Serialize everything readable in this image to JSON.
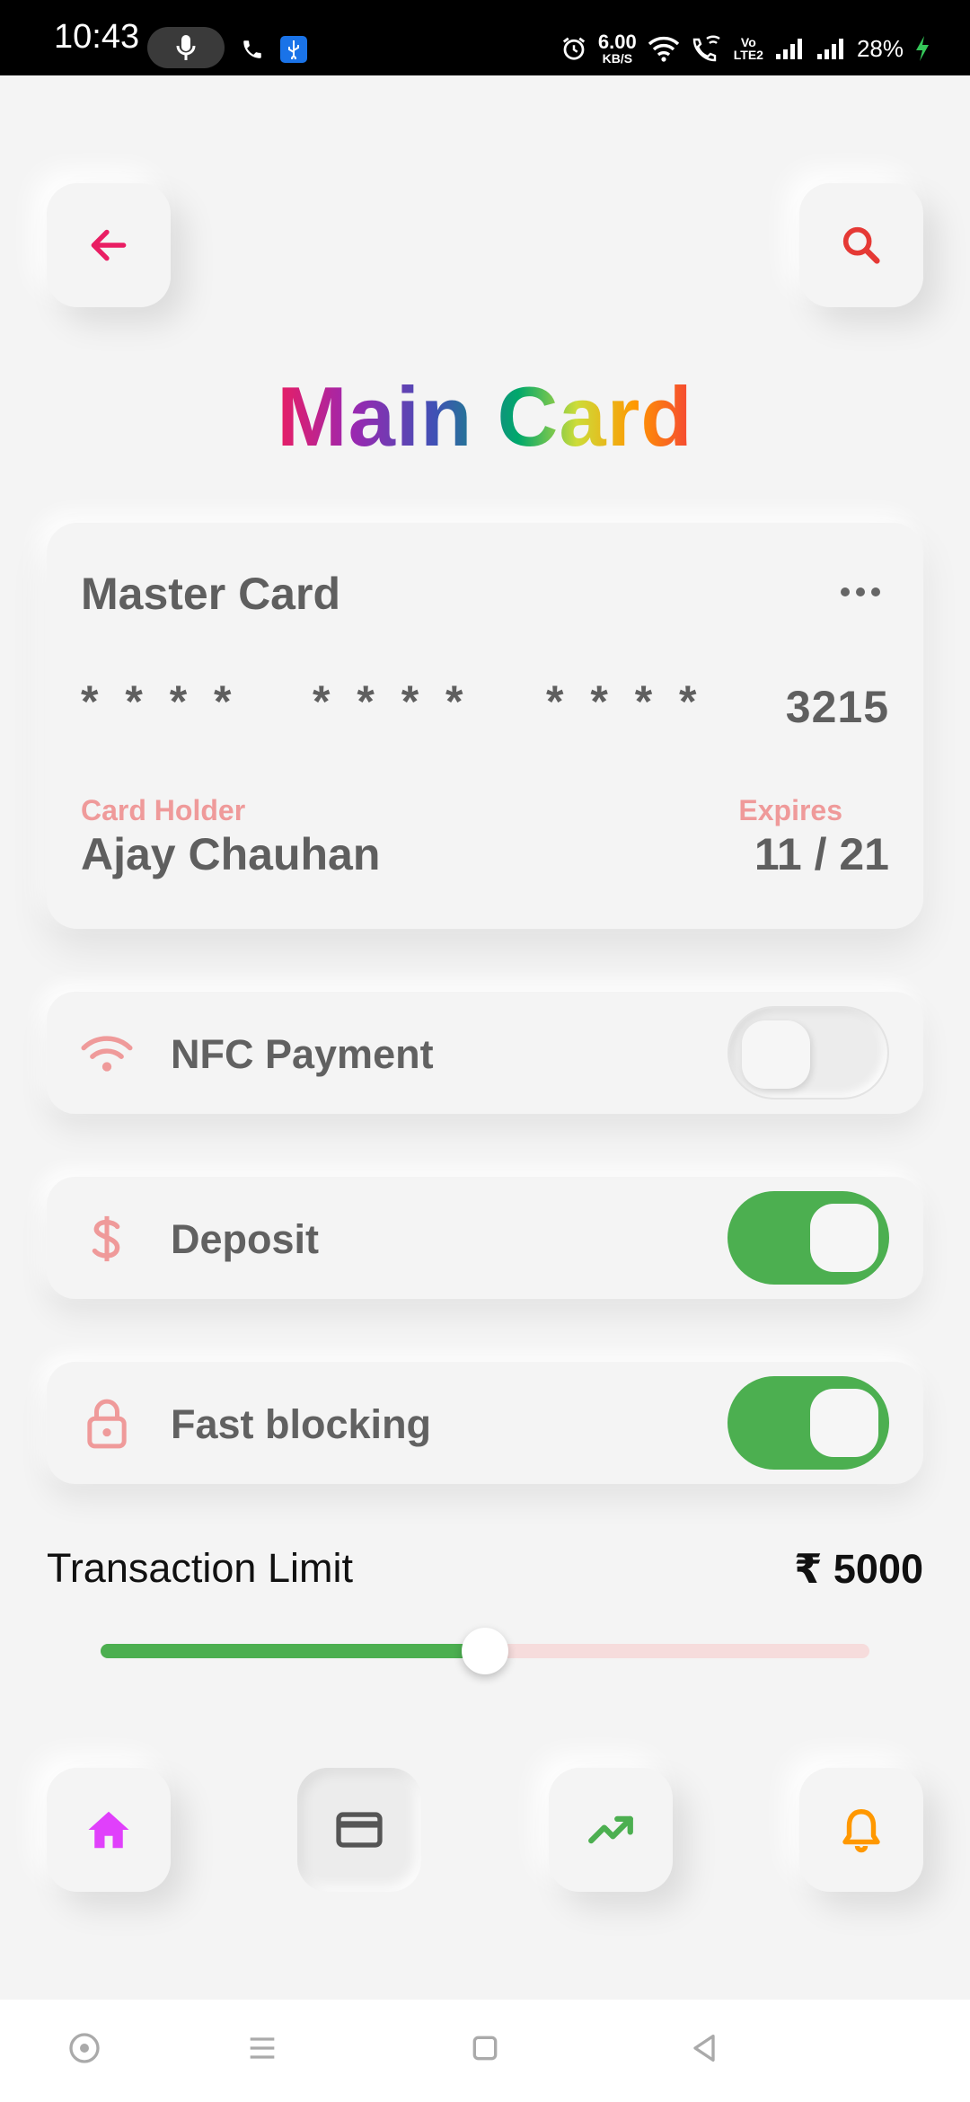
{
  "status_bar": {
    "time": "10:43",
    "net_speed_value": "6.00",
    "net_speed_unit": "KB/S",
    "volte_top": "Vo",
    "volte_bottom": "LTE2",
    "battery": "28%"
  },
  "header": {
    "back_icon": "arrow-left-icon",
    "search_icon": "search-icon",
    "title": "Main Card"
  },
  "card": {
    "name": "Master Card",
    "number_groups": [
      "* * * *",
      "* * * *",
      "* * * *",
      "3215"
    ],
    "holder_label": "Card Holder",
    "holder_name": "Ajay Chauhan",
    "expires_label": "Expires",
    "expires_value": "11 / 21"
  },
  "settings": [
    {
      "label": "NFC Payment",
      "icon": "wifi-icon",
      "enabled": false
    },
    {
      "label": "Deposit",
      "icon": "dollar-icon",
      "enabled": true
    },
    {
      "label": "Fast blocking",
      "icon": "lock-icon",
      "enabled": true
    }
  ],
  "transaction": {
    "title": "Transaction Limit",
    "amount": "₹ 5000",
    "slider_value_fraction": 0.5
  },
  "bottom_nav": [
    {
      "name": "home",
      "icon": "home-icon",
      "color": "#e040fb",
      "active": false
    },
    {
      "name": "cards",
      "icon": "credit-card-icon",
      "color": "#555555",
      "active": true
    },
    {
      "name": "stats",
      "icon": "trending-up-icon",
      "color": "#4caf50",
      "active": false
    },
    {
      "name": "notifications",
      "icon": "bell-icon",
      "color": "#ff9800",
      "active": false
    }
  ],
  "colors": {
    "accent_red": "#e53935",
    "toggle_on": "#4caf50",
    "label_pink": "#ef9a9a",
    "background": "#f4f4f4"
  }
}
